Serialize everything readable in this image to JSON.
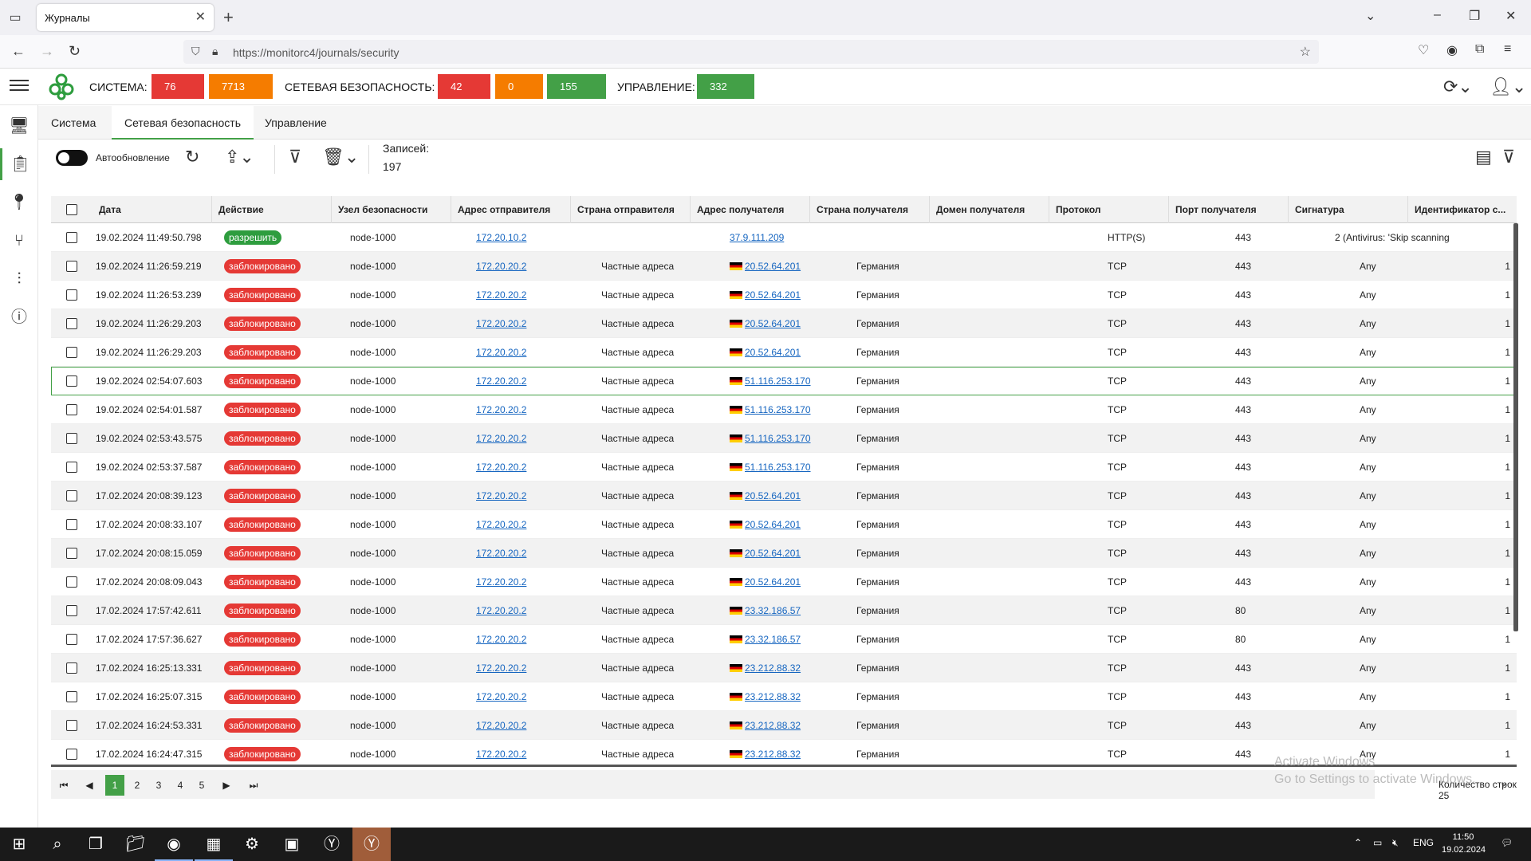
{
  "browser": {
    "tab_title": "Журналы",
    "url": "https://monitorc4/journals/security"
  },
  "header": {
    "system_label": "СИСТЕМА:",
    "system_red": "76",
    "system_orange": "7713",
    "netsec_label": "СЕТЕВАЯ БЕЗОПАСНОСТЬ:",
    "netsec_red": "42",
    "netsec_orange": "0",
    "netsec_green": "155",
    "mgmt_label": "УПРАВЛЕНИЕ:",
    "mgmt_green": "332"
  },
  "tabs": [
    "Система",
    "Сетевая безопасность",
    "Управление"
  ],
  "active_tab": "Сетевая безопасность",
  "toolbar": {
    "autorefresh_label": "Автообновление",
    "records_label": "Записей:",
    "records_value": "197"
  },
  "table": {
    "columns": [
      "Дата",
      "Действие",
      "Узел безопасности",
      "Адрес отправителя",
      "Страна отправителя",
      "Адрес получателя",
      "Страна получателя",
      "Домен получателя",
      "Протокол",
      "Порт получателя",
      "Сигнатура",
      "Идентификатор с..."
    ],
    "rows": [
      {
        "date": "19.02.2024 11:49:50.798",
        "action": "разрешить",
        "node": "node-1000",
        "src": "172.20.10.2",
        "src_country": "",
        "dst": "37.9.111.209",
        "dst_flag": false,
        "dst_country": "",
        "domain": "",
        "proto": "HTTP(S)",
        "port": "443",
        "sig": "",
        "ident": "2 (Antivirus: 'Skip scanning"
      },
      {
        "date": "19.02.2024 11:26:59.219",
        "action": "заблокировано",
        "node": "node-1000",
        "src": "172.20.20.2",
        "src_country": "Частные адреса",
        "dst": "20.52.64.201",
        "dst_flag": true,
        "dst_country": "Германия",
        "domain": "",
        "proto": "TCP",
        "port": "443",
        "sig": "Any",
        "ident": "1"
      },
      {
        "date": "19.02.2024 11:26:53.239",
        "action": "заблокировано",
        "node": "node-1000",
        "src": "172.20.20.2",
        "src_country": "Частные адреса",
        "dst": "20.52.64.201",
        "dst_flag": true,
        "dst_country": "Германия",
        "domain": "",
        "proto": "TCP",
        "port": "443",
        "sig": "Any",
        "ident": "1"
      },
      {
        "date": "19.02.2024 11:26:29.203",
        "action": "заблокировано",
        "node": "node-1000",
        "src": "172.20.20.2",
        "src_country": "Частные адреса",
        "dst": "20.52.64.201",
        "dst_flag": true,
        "dst_country": "Германия",
        "domain": "",
        "proto": "TCP",
        "port": "443",
        "sig": "Any",
        "ident": "1"
      },
      {
        "date": "19.02.2024 11:26:29.203",
        "action": "заблокировано",
        "node": "node-1000",
        "src": "172.20.20.2",
        "src_country": "Частные адреса",
        "dst": "20.52.64.201",
        "dst_flag": true,
        "dst_country": "Германия",
        "domain": "",
        "proto": "TCP",
        "port": "443",
        "sig": "Any",
        "ident": "1"
      },
      {
        "date": "19.02.2024 02:54:07.603",
        "action": "заблокировано",
        "node": "node-1000",
        "src": "172.20.20.2",
        "src_country": "Частные адреса",
        "dst": "51.116.253.170",
        "dst_flag": true,
        "dst_country": "Германия",
        "domain": "",
        "proto": "TCP",
        "port": "443",
        "sig": "Any",
        "ident": "1"
      },
      {
        "date": "19.02.2024 02:54:01.587",
        "action": "заблокировано",
        "node": "node-1000",
        "src": "172.20.20.2",
        "src_country": "Частные адреса",
        "dst": "51.116.253.170",
        "dst_flag": true,
        "dst_country": "Германия",
        "domain": "",
        "proto": "TCP",
        "port": "443",
        "sig": "Any",
        "ident": "1"
      },
      {
        "date": "19.02.2024 02:53:43.575",
        "action": "заблокировано",
        "node": "node-1000",
        "src": "172.20.20.2",
        "src_country": "Частные адреса",
        "dst": "51.116.253.170",
        "dst_flag": true,
        "dst_country": "Германия",
        "domain": "",
        "proto": "TCP",
        "port": "443",
        "sig": "Any",
        "ident": "1"
      },
      {
        "date": "19.02.2024 02:53:37.587",
        "action": "заблокировано",
        "node": "node-1000",
        "src": "172.20.20.2",
        "src_country": "Частные адреса",
        "dst": "51.116.253.170",
        "dst_flag": true,
        "dst_country": "Германия",
        "domain": "",
        "proto": "TCP",
        "port": "443",
        "sig": "Any",
        "ident": "1"
      },
      {
        "date": "17.02.2024 20:08:39.123",
        "action": "заблокировано",
        "node": "node-1000",
        "src": "172.20.20.2",
        "src_country": "Частные адреса",
        "dst": "20.52.64.201",
        "dst_flag": true,
        "dst_country": "Германия",
        "domain": "",
        "proto": "TCP",
        "port": "443",
        "sig": "Any",
        "ident": "1"
      },
      {
        "date": "17.02.2024 20:08:33.107",
        "action": "заблокировано",
        "node": "node-1000",
        "src": "172.20.20.2",
        "src_country": "Частные адреса",
        "dst": "20.52.64.201",
        "dst_flag": true,
        "dst_country": "Германия",
        "domain": "",
        "proto": "TCP",
        "port": "443",
        "sig": "Any",
        "ident": "1"
      },
      {
        "date": "17.02.2024 20:08:15.059",
        "action": "заблокировано",
        "node": "node-1000",
        "src": "172.20.20.2",
        "src_country": "Частные адреса",
        "dst": "20.52.64.201",
        "dst_flag": true,
        "dst_country": "Германия",
        "domain": "",
        "proto": "TCP",
        "port": "443",
        "sig": "Any",
        "ident": "1"
      },
      {
        "date": "17.02.2024 20:08:09.043",
        "action": "заблокировано",
        "node": "node-1000",
        "src": "172.20.20.2",
        "src_country": "Частные адреса",
        "dst": "20.52.64.201",
        "dst_flag": true,
        "dst_country": "Германия",
        "domain": "",
        "proto": "TCP",
        "port": "443",
        "sig": "Any",
        "ident": "1"
      },
      {
        "date": "17.02.2024 17:57:42.611",
        "action": "заблокировано",
        "node": "node-1000",
        "src": "172.20.20.2",
        "src_country": "Частные адреса",
        "dst": "23.32.186.57",
        "dst_flag": true,
        "dst_country": "Германия",
        "domain": "",
        "proto": "TCP",
        "port": "80",
        "sig": "Any",
        "ident": "1"
      },
      {
        "date": "17.02.2024 17:57:36.627",
        "action": "заблокировано",
        "node": "node-1000",
        "src": "172.20.20.2",
        "src_country": "Частные адреса",
        "dst": "23.32.186.57",
        "dst_flag": true,
        "dst_country": "Германия",
        "domain": "",
        "proto": "TCP",
        "port": "80",
        "sig": "Any",
        "ident": "1"
      },
      {
        "date": "17.02.2024 16:25:13.331",
        "action": "заблокировано",
        "node": "node-1000",
        "src": "172.20.20.2",
        "src_country": "Частные адреса",
        "dst": "23.212.88.32",
        "dst_flag": true,
        "dst_country": "Германия",
        "domain": "",
        "proto": "TCP",
        "port": "443",
        "sig": "Any",
        "ident": "1"
      },
      {
        "date": "17.02.2024 16:25:07.315",
        "action": "заблокировано",
        "node": "node-1000",
        "src": "172.20.20.2",
        "src_country": "Частные адреса",
        "dst": "23.212.88.32",
        "dst_flag": true,
        "dst_country": "Германия",
        "domain": "",
        "proto": "TCP",
        "port": "443",
        "sig": "Any",
        "ident": "1"
      },
      {
        "date": "17.02.2024 16:24:53.331",
        "action": "заблокировано",
        "node": "node-1000",
        "src": "172.20.20.2",
        "src_country": "Частные адреса",
        "dst": "23.212.88.32",
        "dst_flag": true,
        "dst_country": "Германия",
        "domain": "",
        "proto": "TCP",
        "port": "443",
        "sig": "Any",
        "ident": "1"
      },
      {
        "date": "17.02.2024 16:24:47.315",
        "action": "заблокировано",
        "node": "node-1000",
        "src": "172.20.20.2",
        "src_country": "Частные адреса",
        "dst": "23.212.88.32",
        "dst_flag": true,
        "dst_country": "Германия",
        "domain": "",
        "proto": "TCP",
        "port": "443",
        "sig": "Any",
        "ident": "1"
      }
    ]
  },
  "pagination": {
    "pages": [
      "1",
      "2",
      "3",
      "4",
      "5"
    ],
    "current": "1",
    "rows_label": "Количество строк 25"
  },
  "watermark": {
    "line1": "Activate Windows",
    "line2": "Go to Settings to activate Windows."
  },
  "taskbar": {
    "lang": "ENG",
    "time": "11:50",
    "date": "19.02.2024"
  },
  "colors": {
    "accent": "#43a047",
    "red": "#e53935",
    "orange": "#f57c00",
    "link": "#1565c0"
  }
}
